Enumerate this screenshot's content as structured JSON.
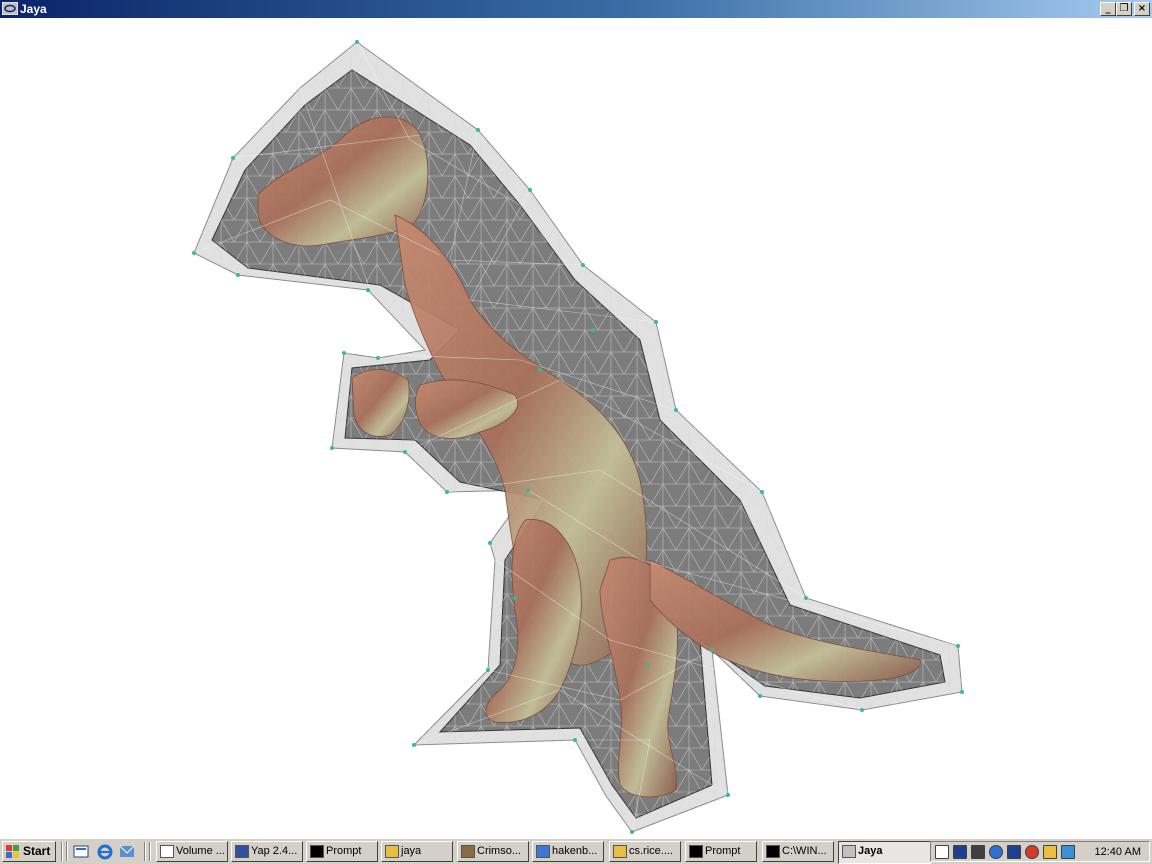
{
  "window": {
    "title": "Jaya",
    "minimize_glyph": "_",
    "maximize_glyph": "❐",
    "close_glyph": "×"
  },
  "taskbar": {
    "start_label": "Start",
    "quicklaunch": [
      "show-desktop-icon",
      "internet-explorer-icon",
      "outlook-icon"
    ],
    "tasks": [
      {
        "label": "Volume ...",
        "icon": "document-icon"
      },
      {
        "label": "Yap 2.4...",
        "icon": "dvi-viewer-icon"
      },
      {
        "label": "Prompt",
        "icon": "console-icon"
      },
      {
        "label": "jaya",
        "icon": "folder-search-icon"
      },
      {
        "label": "Crimso...",
        "icon": "people-icon"
      },
      {
        "label": "hakenb...",
        "icon": "web-page-icon"
      },
      {
        "label": "cs.rice....",
        "icon": "network-folder-icon"
      },
      {
        "label": "Prompt",
        "icon": "console-icon"
      },
      {
        "label": "C:\\WIN...",
        "icon": "console-icon"
      },
      {
        "label": "Jaya",
        "icon": "jaya-app-icon",
        "active": true
      }
    ],
    "tray_icons": [
      "vc-icon",
      "network-activity-icon",
      "volume-icon",
      "globe-icon",
      "shield-icon",
      "color-wheel-icon",
      "pencil-icon",
      "monitor-icon"
    ],
    "clock": "12:40 AM"
  },
  "colors": {
    "titlebar_start": "#0a246a",
    "titlebar_end": "#a6caf0",
    "taskbar": "#d4d0c8",
    "mesh_fill": "#5a5a5a",
    "model_skin": "#b9826a",
    "vertex": "#3fb59a"
  }
}
